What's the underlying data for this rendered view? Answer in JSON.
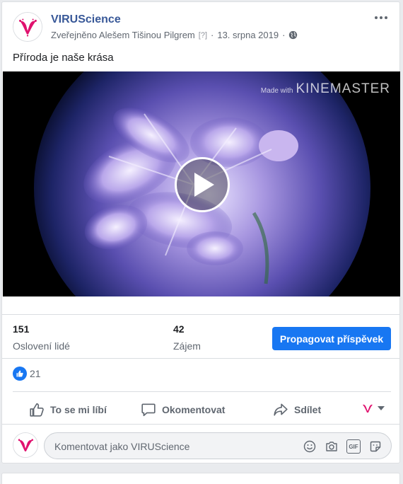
{
  "post": {
    "page_name": "VIRUScience",
    "meta_published_by": "Zveřejněno Alešem Tišinou Pilgrem",
    "meta_help": "[?]",
    "meta_sep": "·",
    "meta_date": "13. srpna 2019",
    "meta_sep2": "·",
    "text": "Příroda je naše krása",
    "privacy_icon": "globe-icon",
    "more_icon": "more-options-icon"
  },
  "video": {
    "watermark_small": "Made with",
    "watermark_brand": "KINEMASTER",
    "play_icon": "play-icon"
  },
  "insights": {
    "reach_value": "151",
    "reach_label": "Oslovení lidé",
    "engagement_value": "42",
    "engagement_label": "Zájem",
    "boost_label": "Propagovat příspěvek"
  },
  "reactions": {
    "count": "21",
    "icon": "like-reaction-icon"
  },
  "actions": {
    "like": "To se mi líbí",
    "comment": "Okomentovat",
    "share": "Sdílet"
  },
  "comment_box": {
    "placeholder": "Komentovat jako VIRUScience",
    "icons": [
      "emoji-icon",
      "camera-icon",
      "gif-icon",
      "sticker-icon"
    ],
    "gif_text": "GIF"
  },
  "colors": {
    "brand_blue": "#1877f2",
    "link_blue": "#385898",
    "logo_pink": "#e0116e"
  }
}
